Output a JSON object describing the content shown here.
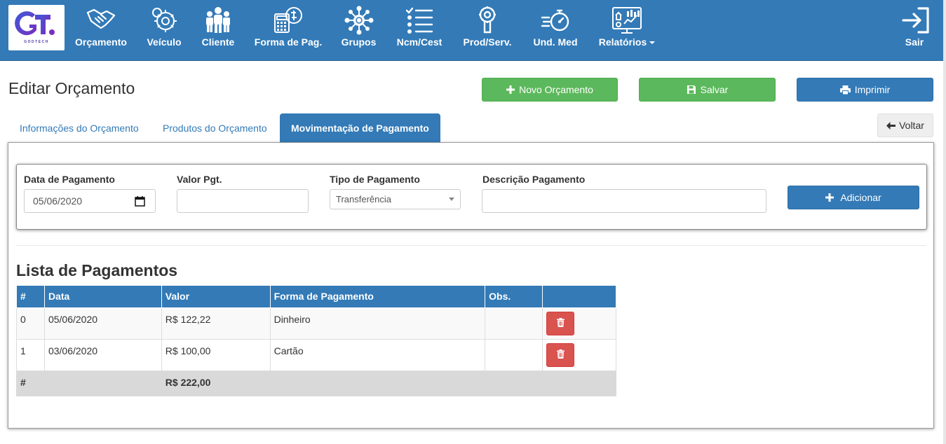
{
  "brand": {
    "logo_text": "GT",
    "logo_sub": "GODTECH"
  },
  "nav": {
    "items": [
      {
        "label": "Orçamento",
        "icon": "handshake-icon"
      },
      {
        "label": "Veículo",
        "icon": "engine-icon"
      },
      {
        "label": "Cliente",
        "icon": "people-icon"
      },
      {
        "label": "Forma de Pag.",
        "icon": "calculator-icon"
      },
      {
        "label": "Grupos",
        "icon": "network-icon"
      },
      {
        "label": "Ncm/Cest",
        "icon": "checklist-icon"
      },
      {
        "label": "Prod/Serv.",
        "icon": "wrench-icon"
      },
      {
        "label": "Und. Med",
        "icon": "stopwatch-icon"
      },
      {
        "label": "Relatórios",
        "icon": "report-icon"
      }
    ],
    "logout_label": "Sair"
  },
  "page": {
    "title": "Editar Orçamento"
  },
  "actions": {
    "new_label": "Novo Orçamento",
    "save_label": "Salvar",
    "print_label": "Imprimir",
    "back_label": "Voltar"
  },
  "tabs": [
    {
      "label": "Informações do Orçamento",
      "active": false
    },
    {
      "label": "Produtos do Orçamento",
      "active": false
    },
    {
      "label": "Movimentação de Pagamento",
      "active": true
    }
  ],
  "form": {
    "date_label": "Data de Pagamento",
    "date_value": "05/06/2020",
    "value_label": "Valor Pgt.",
    "value_value": "",
    "type_label": "Tipo de Pagamento",
    "type_value": "Transferência",
    "desc_label": "Descrição Pagamento",
    "desc_value": "",
    "add_label": "Adicionar"
  },
  "list": {
    "title": "Lista de Pagamentos",
    "columns": [
      "#",
      "Data",
      "Valor",
      "Forma de Pagamento",
      "Obs.",
      ""
    ],
    "rows": [
      {
        "index": "0",
        "date": "05/06/2020",
        "value": "R$ 122,22",
        "method": "Dinheiro",
        "obs": ""
      },
      {
        "index": "1",
        "date": "03/06/2020",
        "value": "R$ 100,00",
        "method": "Cartão",
        "obs": ""
      }
    ],
    "total": {
      "label": "#",
      "value": "R$ 222,00"
    }
  },
  "colors": {
    "primary": "#337ab7",
    "success": "#5cb85c",
    "danger": "#d9534f"
  }
}
